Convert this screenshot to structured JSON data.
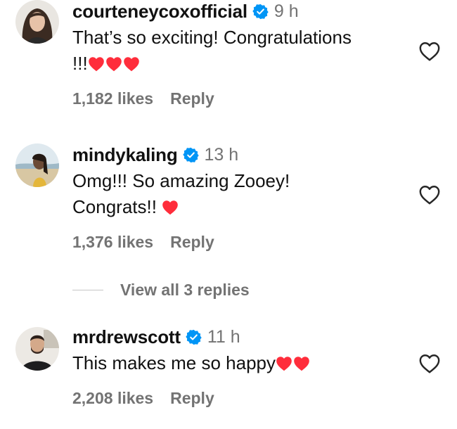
{
  "colors": {
    "text": "#111111",
    "muted": "#737373",
    "verified": "#0095F6",
    "heart": "#FF2D3B"
  },
  "comments": [
    {
      "username": "courteneycoxofficial",
      "verified": true,
      "time": "9 h",
      "text_lines": [
        "That’s so exciting! Congratulations",
        "!!!"
      ],
      "hearts": 3,
      "likes": "1,182 likes",
      "reply_label": "Reply",
      "like_icon": "heart-outline-icon"
    },
    {
      "username": "mindykaling",
      "verified": true,
      "time": "13 h",
      "text_lines": [
        "Omg!!! So amazing Zooey!",
        "Congrats!! "
      ],
      "hearts": 1,
      "likes": "1,376 likes",
      "reply_label": "Reply",
      "like_icon": "heart-outline-icon"
    },
    {
      "username": "mrdrewscott",
      "verified": true,
      "time": "11 h",
      "text_lines": [
        "This makes me so happy"
      ],
      "hearts": 2,
      "likes": "2,208 likes",
      "reply_label": "Reply",
      "like_icon": "heart-outline-icon"
    }
  ],
  "view_replies": {
    "label": "View all 3 replies"
  }
}
